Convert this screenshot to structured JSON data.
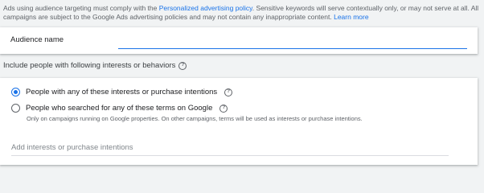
{
  "notice": {
    "text_before": "Ads using audience targeting must comply with the ",
    "link_policy": "Personalized advertising policy",
    "text_middle": ". Sensitive keywords will serve contextually only, or may not serve at all. All campaigns are subject to the Google Ads advertising policies and may not contain any inappropriate content. ",
    "link_learn_more": "Learn more"
  },
  "audience_name": {
    "label": "Audience name",
    "value": ""
  },
  "section": {
    "title": "Include people with following interests or behaviors",
    "help_icon": "?"
  },
  "options": [
    {
      "label": "People with any of these interests or purchase intentions",
      "selected": true,
      "help_icon": "?"
    },
    {
      "label": "People who searched for any of these terms on Google",
      "selected": false,
      "help_icon": "?",
      "note": "Only on campaigns running on Google properties. On other campaigns, terms will be used as interests or purchase intentions."
    }
  ],
  "add_interests": {
    "placeholder": "Add interests or purchase intentions",
    "value": ""
  },
  "colors": {
    "accent": "#1a73e8",
    "background": "#f1f3f4",
    "card": "#ffffff"
  }
}
